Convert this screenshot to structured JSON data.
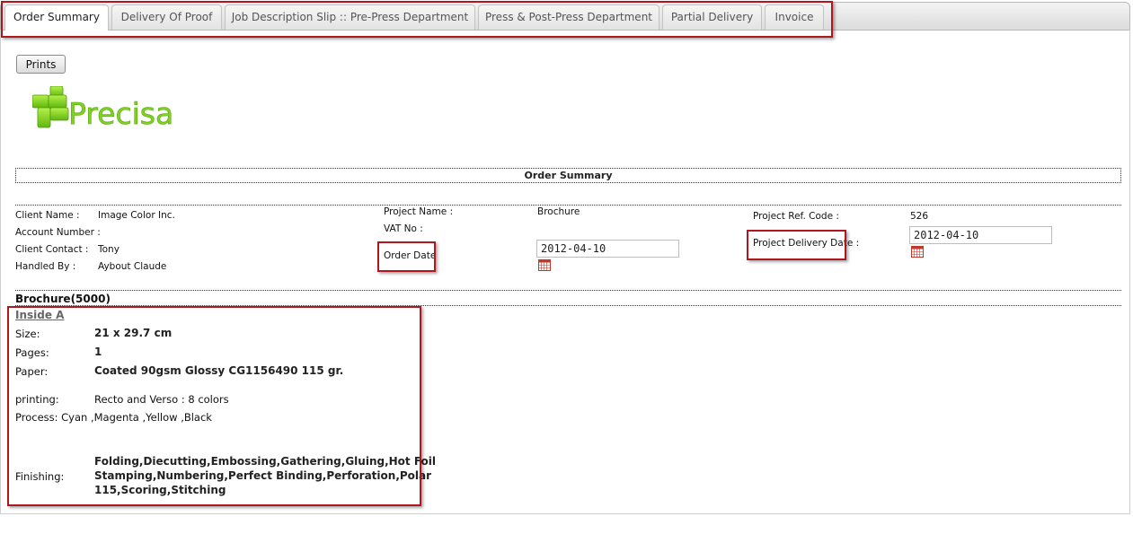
{
  "tabs": [
    {
      "label": "Order Summary",
      "active": true
    },
    {
      "label": "Delivery Of Proof",
      "active": false
    },
    {
      "label": "Job Description Slip :: Pre-Press Department",
      "active": false
    },
    {
      "label": "Press & Post-Press Department",
      "active": false
    },
    {
      "label": "Partial Delivery",
      "active": false
    },
    {
      "label": "Invoice",
      "active": false
    }
  ],
  "toolbar": {
    "prints_label": "Prints"
  },
  "logo": {
    "text": "Precisa",
    "color": "#7ed321"
  },
  "section_title": "Order Summary",
  "client": {
    "name_label": "Client Name :",
    "name_value": "Image Color Inc.",
    "account_label": "Account Number :",
    "account_value": "",
    "contact_label": "Client Contact :",
    "contact_value": "Tony",
    "handled_label": "Handled By :",
    "handled_value": "Aybout Claude"
  },
  "project": {
    "name_label": "Project Name :",
    "name_value": "Brochure",
    "vat_label": "VAT No :",
    "vat_value": "",
    "order_date_label": "Order Date",
    "order_date_value": "2012-04-10",
    "ref_label": "Project Ref. Code :",
    "ref_value": "526",
    "delivery_label": "Project Delivery Date :",
    "delivery_value": "2012-04-10"
  },
  "product": {
    "heading": "Brochure(5000)",
    "part_link": "Inside A",
    "size_label": "Size:",
    "size_value": "21 x 29.7 cm",
    "pages_label": "Pages:",
    "pages_value": "1",
    "paper_label": "Paper:",
    "paper_value": "Coated 90gsm Glossy CG1156490 115 gr.",
    "printing_label": "printing:",
    "printing_value": "Recto and Verso : 8 colors",
    "process_text": "Process: Cyan ,Magenta ,Yellow ,Black",
    "finishing_label": "Finishing:",
    "finishing_lines": [
      "Folding,Diecutting,Embossing,Gathering,Gluing,Hot Foil",
      "Stamping,Numbering,Perfect Binding,Perforation,Polar",
      "115,Scoring,Stitching"
    ]
  },
  "colors": {
    "highlight": "#b0161d",
    "calendar": "#c0392b"
  }
}
